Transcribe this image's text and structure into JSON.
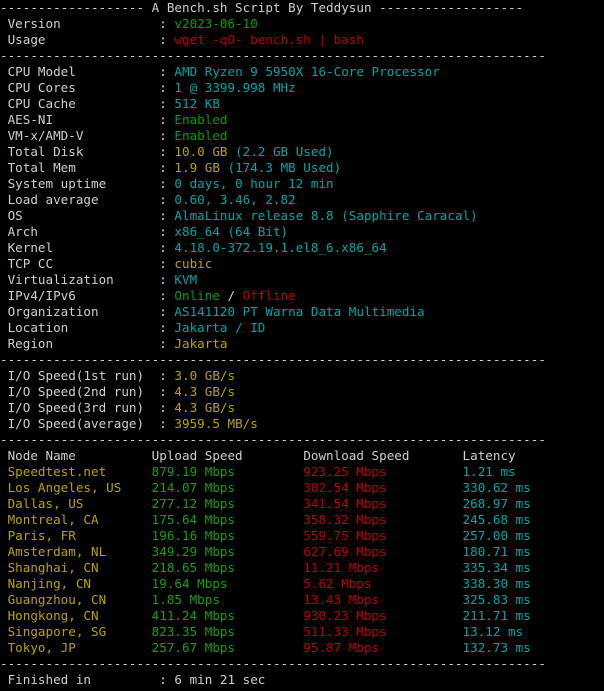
{
  "terminal": {
    "background": "#000000",
    "colors": {
      "white": "#cfd0d0",
      "green": "#00a000",
      "red": "#c00000",
      "cyan": "#00a6a6",
      "yellow": "#b8a400"
    }
  },
  "header": {
    "separator_left": "-------------------",
    "title": "A Bench.sh Script By Teddysun",
    "separator_right": "-------------------",
    "divider": "------------------------------------------------------------------------"
  },
  "meta": {
    "rows": [
      {
        "label": "Version",
        "colon": ":",
        "value": "v2023-06-10",
        "value_class": "g"
      },
      {
        "label": "Usage",
        "colon": ":",
        "value": "wget -qO- bench.sh | bash",
        "value_class": "r"
      }
    ]
  },
  "sysinfo": {
    "rows": [
      {
        "label": "CPU Model",
        "colon": ":",
        "value": "AMD Ryzen 9 5950X 16-Core Processor",
        "value_class": "c"
      },
      {
        "label": "CPU Cores",
        "colon": ":",
        "value": "1 @ 3399.998 MHz",
        "value_class": "c"
      },
      {
        "label": "CPU Cache",
        "colon": ":",
        "value": "512 KB",
        "value_class": "c"
      },
      {
        "label": "AES-NI",
        "colon": ":",
        "value": "Enabled",
        "value_class": "g"
      },
      {
        "label": "VM-x/AMD-V",
        "colon": ":",
        "value": "Enabled",
        "value_class": "g"
      },
      {
        "label": "Total Disk",
        "colon": ":",
        "value": "10.0 GB",
        "value_class": "y",
        "extra": " (2.2 GB Used)",
        "extra_class": "c"
      },
      {
        "label": "Total Mem",
        "colon": ":",
        "value": "1.9 GB",
        "value_class": "y",
        "extra": " (174.3 MB Used)",
        "extra_class": "c"
      },
      {
        "label": "System uptime",
        "colon": ":",
        "value": "0 days, 0 hour 12 min",
        "value_class": "c"
      },
      {
        "label": "Load average",
        "colon": ":",
        "value": "0.60, 3.46, 2.82",
        "value_class": "c"
      },
      {
        "label": "OS",
        "colon": ":",
        "value": "AlmaLinux release 8.8 (Sapphire Caracal)",
        "value_class": "c"
      },
      {
        "label": "Arch",
        "colon": ":",
        "value": "x86_64 (64 Bit)",
        "value_class": "c"
      },
      {
        "label": "Kernel",
        "colon": ":",
        "value": "4.18.0-372.19.1.el8_6.x86_64",
        "value_class": "c"
      },
      {
        "label": "TCP CC",
        "colon": ":",
        "value": "cubic",
        "value_class": "y"
      },
      {
        "label": "Virtualization",
        "colon": ":",
        "value": "KVM",
        "value_class": "c"
      },
      {
        "label": "IPv4/IPv6",
        "colon": ":",
        "value": "Online",
        "value_class": "g",
        "extra": " / ",
        "extra_class": "w",
        "extra2": "Offline",
        "extra2_class": "r"
      },
      {
        "label": "Organization",
        "colon": ":",
        "value": "AS141120 PT Warna Data Multimedia",
        "value_class": "c"
      },
      {
        "label": "Location",
        "colon": ":",
        "value": "Jakarta / ID",
        "value_class": "c"
      },
      {
        "label": "Region",
        "colon": ":",
        "value": "Jakarta",
        "value_class": "y"
      }
    ]
  },
  "iospeed": {
    "rows": [
      {
        "label": "I/O Speed(1st run)",
        "colon": ":",
        "value": "3.0 GB/s",
        "value_class": "y"
      },
      {
        "label": "I/O Speed(2nd run)",
        "colon": ":",
        "value": "4.3 GB/s",
        "value_class": "y"
      },
      {
        "label": "I/O Speed(3rd run)",
        "colon": ":",
        "value": "4.3 GB/s",
        "value_class": "y"
      },
      {
        "label": "I/O Speed(average)",
        "colon": ":",
        "value": "3959.5 MB/s",
        "value_class": "y"
      }
    ]
  },
  "speedtest": {
    "columns": {
      "node": "Node Name",
      "upload": "Upload Speed",
      "download": "Download Speed",
      "latency": "Latency"
    },
    "rows": [
      {
        "node": "Speedtest.net",
        "upload": "879.19 Mbps",
        "download": "923.25 Mbps",
        "latency": "1.21 ms"
      },
      {
        "node": "Los Angeles, US",
        "upload": "214.07 Mbps",
        "download": "302.54 Mbps",
        "latency": "330.62 ms"
      },
      {
        "node": "Dallas, US",
        "upload": "277.12 Mbps",
        "download": "341.54 Mbps",
        "latency": "268.97 ms"
      },
      {
        "node": "Montreal, CA",
        "upload": "175.64 Mbps",
        "download": "358.32 Mbps",
        "latency": "245.68 ms"
      },
      {
        "node": "Paris, FR",
        "upload": "196.16 Mbps",
        "download": "559.75 Mbps",
        "latency": "257.00 ms"
      },
      {
        "node": "Amsterdam, NL",
        "upload": "349.29 Mbps",
        "download": "627.69 Mbps",
        "latency": "180.71 ms"
      },
      {
        "node": "Shanghai, CN",
        "upload": "218.65 Mbps",
        "download": "11.21 Mbps",
        "latency": "335.34 ms"
      },
      {
        "node": "Nanjing, CN",
        "upload": "19.64 Mbps",
        "download": "5.62 Mbps",
        "latency": "338.30 ms"
      },
      {
        "node": "Guangzhou, CN",
        "upload": "1.85 Mbps",
        "download": "13.43 Mbps",
        "latency": "325.83 ms"
      },
      {
        "node": "Hongkong, CN",
        "upload": "411.24 Mbps",
        "download": "930.23 Mbps",
        "latency": "211.71 ms"
      },
      {
        "node": "Singapore, SG",
        "upload": "823.35 Mbps",
        "download": "511.33 Mbps",
        "latency": "13.12 ms"
      },
      {
        "node": "Tokyo, JP",
        "upload": "257.67 Mbps",
        "download": "95.87 Mbps",
        "latency": "132.73 ms"
      }
    ]
  },
  "footer": {
    "label": "Finished in",
    "colon": ":",
    "value": "6 min 21 sec"
  }
}
